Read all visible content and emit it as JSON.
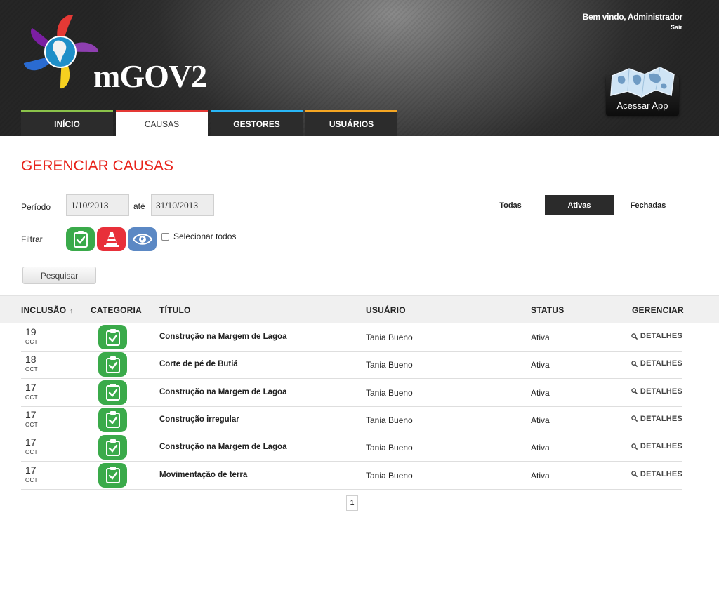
{
  "header": {
    "logo_text": "mGOV2",
    "welcome": "Bem vindo, Administrador",
    "logout": "Sair",
    "app_button": "Acessar App"
  },
  "tabs": [
    {
      "label": "INÍCIO",
      "color": "#8bc34a"
    },
    {
      "label": "CAUSAS",
      "color": "#e53935",
      "active": true
    },
    {
      "label": "GESTORES",
      "color": "#29b6f6"
    },
    {
      "label": "USUÁRIOS",
      "color": "#f5a623"
    }
  ],
  "main": {
    "title": "GERENCIAR CAUSAS",
    "period_label": "Período",
    "date_from": "1/10/2013",
    "until_label": "até",
    "date_to": "31/10/2013",
    "status_options": [
      "Todas",
      "Ativas",
      "Fechadas"
    ],
    "status_selected": "Ativas",
    "filter_label": "Filtrar",
    "filter_icons": [
      "clipboard-check-icon",
      "traffic-cone-icon",
      "eye-icon"
    ],
    "select_all_label": "Selecionar todos",
    "search_button": "Pesquisar",
    "accent_color": "#e8231b"
  },
  "table": {
    "headers": {
      "inclusion": "INCLUSÃO",
      "category": "CATEGORIA",
      "title": "TÍTULO",
      "user": "USUÁRIO",
      "status": "STATUS",
      "manage": "GERENCIAR"
    },
    "sort_indicator": "↑",
    "details_label": "DETALHES",
    "rows": [
      {
        "day": "19",
        "month": "OCT",
        "title": "Construção na Margem de Lagoa",
        "user": "Tania Bueno",
        "status": "Ativa"
      },
      {
        "day": "18",
        "month": "OCT",
        "title": "Corte de pé de Butiá",
        "user": "Tania Bueno",
        "status": "Ativa"
      },
      {
        "day": "17",
        "month": "OCT",
        "title": "Construção na Margem de Lagoa",
        "user": "Tania Bueno",
        "status": "Ativa"
      },
      {
        "day": "17",
        "month": "OCT",
        "title": "Construção irregular",
        "user": "Tania Bueno",
        "status": "Ativa"
      },
      {
        "day": "17",
        "month": "OCT",
        "title": "Construção na Margem de Lagoa",
        "user": "Tania Bueno",
        "status": "Ativa"
      },
      {
        "day": "17",
        "month": "OCT",
        "title": "Movimentação de terra",
        "user": "Tania Bueno",
        "status": "Ativa"
      }
    ]
  },
  "pagination": {
    "current_page": "1"
  }
}
